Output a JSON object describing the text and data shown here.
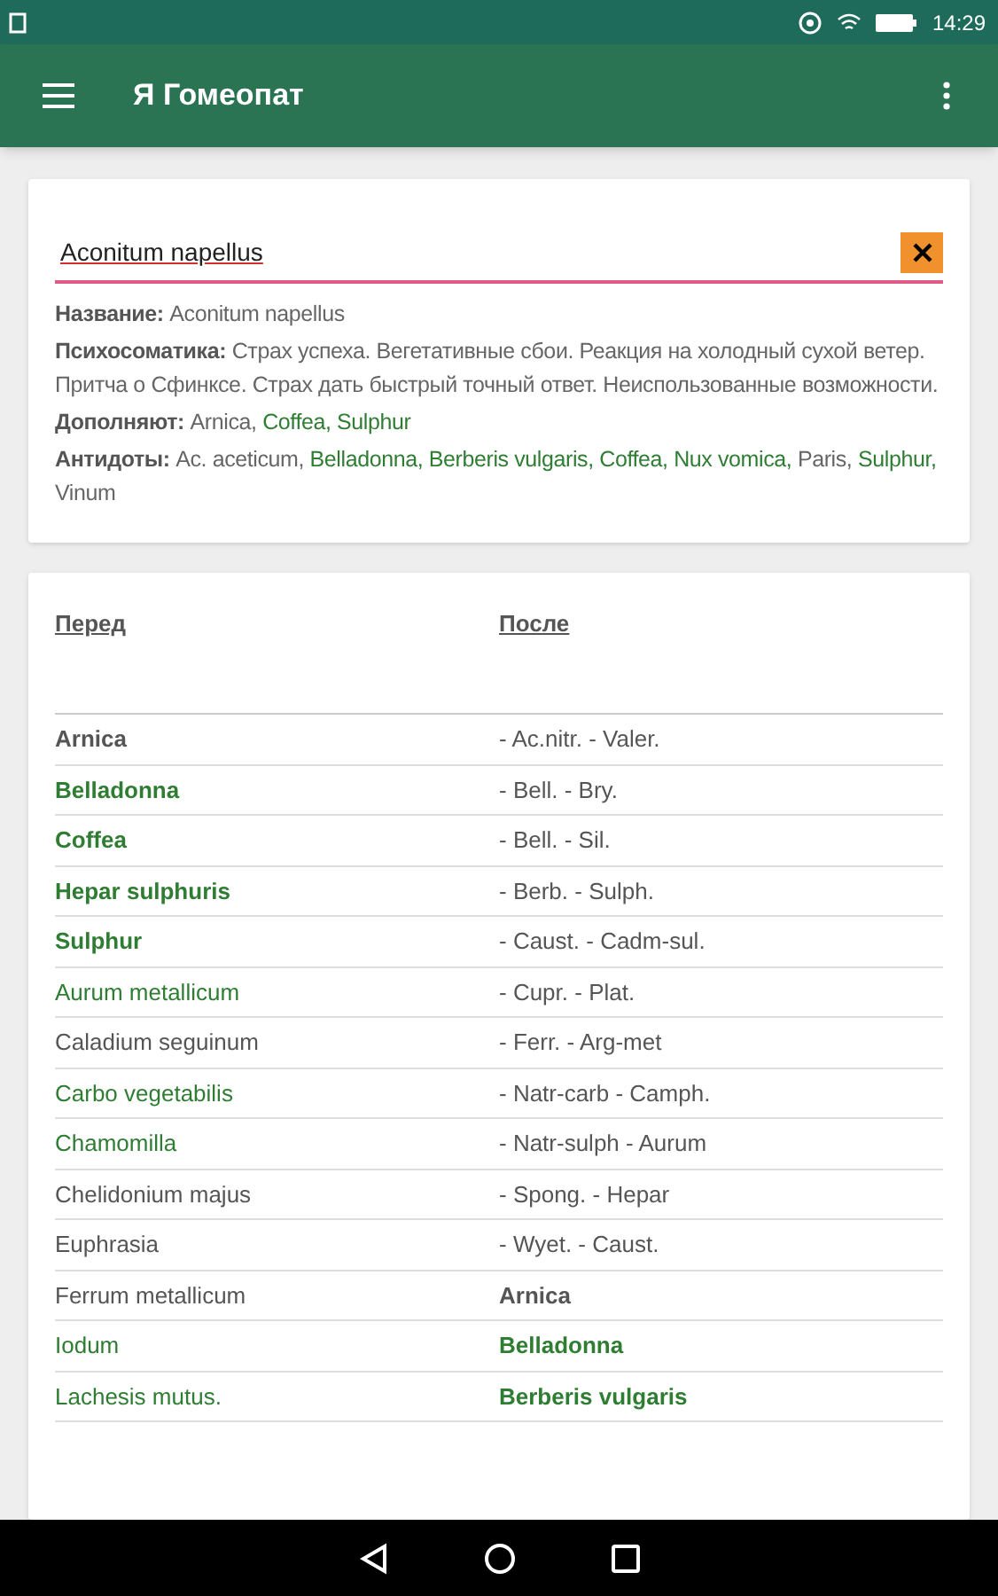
{
  "status_bar": {
    "time": "14:29"
  },
  "app_bar": {
    "title": "Я Гомеопат"
  },
  "search": {
    "value": "Aconitum napellus"
  },
  "info": [
    {
      "label": "Название:",
      "parts": [
        {
          "text": "Aconitum napellus",
          "green": false
        }
      ]
    },
    {
      "label": "Психосоматика:",
      "parts": [
        {
          "text": "Страх успеха. Вегетативные сбои. Реакция на холодный сухой ветер. Притча о Сфинксе. Страх дать быстрый точный ответ. Неиспользованные возможности.",
          "green": false
        }
      ]
    },
    {
      "label": "Дополняют:",
      "parts": [
        {
          "text": "Arnica,",
          "green": false
        },
        {
          "text": "Coffea,",
          "green": true
        },
        {
          "text": "Sulphur",
          "green": true
        }
      ]
    },
    {
      "label": "Антидоты:",
      "parts": [
        {
          "text": "Ac. aceticum,",
          "green": false
        },
        {
          "text": "Belladonna,",
          "green": true
        },
        {
          "text": "Berberis vulgaris,",
          "green": true
        },
        {
          "text": "Coffea,",
          "green": true
        },
        {
          "text": "Nux vomica,",
          "green": true
        },
        {
          "text": "Paris,",
          "green": false
        },
        {
          "text": "Sulphur,",
          "green": true
        },
        {
          "text": "Vinum",
          "green": false
        }
      ]
    }
  ],
  "table": {
    "columns": [
      "Перед",
      "После"
    ],
    "rows": [
      [
        {
          "text": "Arnica",
          "bold": true,
          "green": false
        },
        {
          "text": "- Ac.nitr. - Valer.",
          "bold": false,
          "green": false
        }
      ],
      [
        {
          "text": "Belladonna",
          "bold": true,
          "green": true
        },
        {
          "text": "- Bell. - Bry.",
          "bold": false,
          "green": false
        }
      ],
      [
        {
          "text": "Coffea",
          "bold": true,
          "green": true
        },
        {
          "text": "- Bell. - Sil.",
          "bold": false,
          "green": false
        }
      ],
      [
        {
          "text": "Hepar sulphuris",
          "bold": true,
          "green": true
        },
        {
          "text": "- Berb. - Sulph.",
          "bold": false,
          "green": false
        }
      ],
      [
        {
          "text": "Sulphur",
          "bold": true,
          "green": true
        },
        {
          "text": "- Caust. - Cadm-sul.",
          "bold": false,
          "green": false
        }
      ],
      [
        {
          "text": "Aurum metallicum",
          "bold": false,
          "green": true
        },
        {
          "text": "- Cupr. - Plat.",
          "bold": false,
          "green": false
        }
      ],
      [
        {
          "text": "Caladium seguinum",
          "bold": false,
          "green": false
        },
        {
          "text": "- Ferr. - Arg-met",
          "bold": false,
          "green": false
        }
      ],
      [
        {
          "text": "Carbo vegetabilis",
          "bold": false,
          "green": true
        },
        {
          "text": "- Natr-carb - Camph.",
          "bold": false,
          "green": false
        }
      ],
      [
        {
          "text": "Chamomilla",
          "bold": false,
          "green": true
        },
        {
          "text": "- Natr-sulph - Aurum",
          "bold": false,
          "green": false
        }
      ],
      [
        {
          "text": "Chelidonium majus",
          "bold": false,
          "green": false
        },
        {
          "text": "- Spong. - Hepar",
          "bold": false,
          "green": false
        }
      ],
      [
        {
          "text": "Euphrasia",
          "bold": false,
          "green": false
        },
        {
          "text": "- Wyet. - Caust.",
          "bold": false,
          "green": false
        }
      ],
      [
        {
          "text": "Ferrum metallicum",
          "bold": false,
          "green": false
        },
        {
          "text": "Arnica",
          "bold": true,
          "green": false
        }
      ],
      [
        {
          "text": "Iodum",
          "bold": false,
          "green": true
        },
        {
          "text": "Belladonna",
          "bold": true,
          "green": true
        }
      ],
      [
        {
          "text": "Lachesis mutus.",
          "bold": false,
          "green": true
        },
        {
          "text": "Berberis vulgaris",
          "bold": true,
          "green": true
        }
      ]
    ]
  }
}
